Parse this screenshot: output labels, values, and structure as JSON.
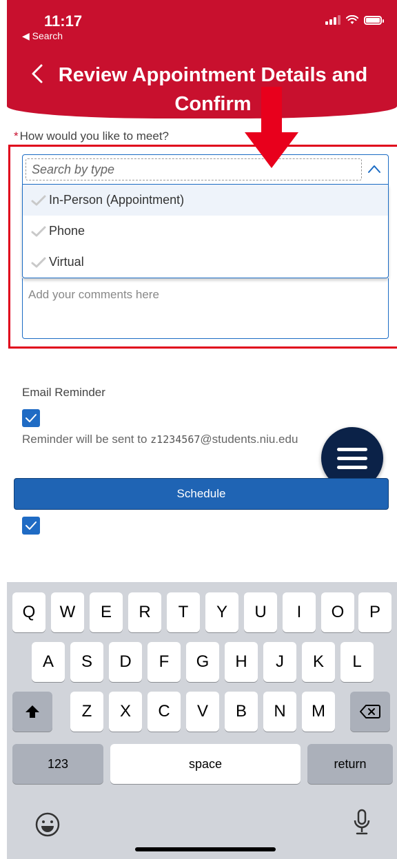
{
  "status_bar": {
    "time": "11:17",
    "back_app": "◀ Search"
  },
  "header": {
    "title": "Review Appointment Details and Confirm"
  },
  "form": {
    "question": "How would you like to meet?",
    "required_marker": "*",
    "search_placeholder": "Search by type",
    "options": [
      "In-Person (Appointment)",
      "Phone",
      "Virtual"
    ],
    "comments_placeholder": "Add your comments here",
    "email_reminder_label": "Email Reminder",
    "email_reminder_checked": true,
    "reminder_prefix": "Reminder will be sent to ",
    "reminder_id_letter": "z",
    "reminder_id_digits": "1234567",
    "reminder_domain": "@students.niu.edu",
    "schedule_label": "Schedule",
    "second_checkbox_checked": true
  },
  "keyboard": {
    "row1": [
      "Q",
      "W",
      "E",
      "R",
      "T",
      "Y",
      "U",
      "I",
      "O",
      "P"
    ],
    "row2": [
      "A",
      "S",
      "D",
      "F",
      "G",
      "H",
      "J",
      "K",
      "L"
    ],
    "row3": [
      "Z",
      "X",
      "C",
      "V",
      "B",
      "N",
      "M"
    ],
    "numbers_label": "123",
    "space_label": "space",
    "return_label": "return"
  },
  "colors": {
    "header": "#c8102e",
    "accent": "#1f64b4",
    "fab": "#0b2248",
    "highlight": "#e0001b"
  }
}
